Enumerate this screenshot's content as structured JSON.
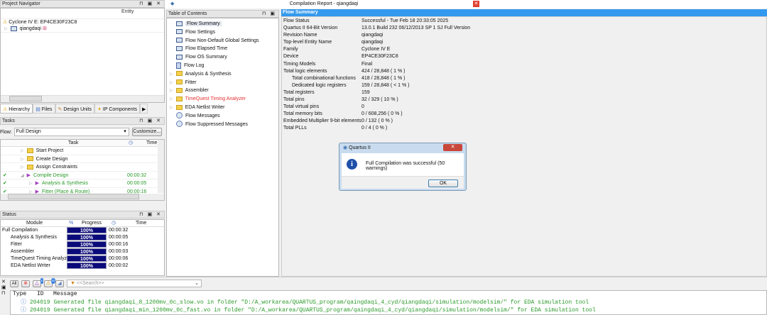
{
  "project_navigator": {
    "title": "Project Navigator",
    "column": "Entity",
    "device": "Cyclone IV E: EP4CE30F23C8",
    "entity": "qiangdaqi",
    "tabs": [
      "Hierarchy",
      "Files",
      "Design Units",
      "IP Components"
    ]
  },
  "tasks": {
    "title": "Tasks",
    "flow_label": "Flow:",
    "flow_value": "Full Design",
    "customize": "Customize...",
    "col_task": "Task",
    "col_time": "Time",
    "rows": [
      {
        "label": "Start Project",
        "time": "",
        "done": false,
        "level": 1
      },
      {
        "label": "Create Design",
        "time": "",
        "done": false,
        "level": 1
      },
      {
        "label": "Assign Constraints",
        "time": "",
        "done": false,
        "level": 1
      },
      {
        "label": "Compile Design",
        "time": "00:00:32",
        "done": true,
        "level": 1
      },
      {
        "label": "Analysis & Synthesis",
        "time": "00:00:05",
        "done": true,
        "level": 2
      },
      {
        "label": "Fitter (Place & Route)",
        "time": "00:00:16",
        "done": true,
        "level": 2
      }
    ]
  },
  "status": {
    "title": "Status",
    "col_module": "Module",
    "col_progress": "Progress",
    "col_time": "Time",
    "rows": [
      {
        "module": "Full Compilation",
        "progress": "100%",
        "time": "00:00:32"
      },
      {
        "module": "Analysis & Synthesis",
        "progress": "100%",
        "time": "00:00:05"
      },
      {
        "module": "Fitter",
        "progress": "100%",
        "time": "00:00:16"
      },
      {
        "module": "Assembler",
        "progress": "100%",
        "time": "00:00:03"
      },
      {
        "module": "TimeQuest Timing Analyzer",
        "progress": "100%",
        "time": "00:00:06"
      },
      {
        "module": "EDA Netlist Writer",
        "progress": "100%",
        "time": "00:00:02"
      }
    ]
  },
  "report": {
    "title": "Compilation Report - qiangdaqi",
    "toc_title": "Table of Contents",
    "toc": [
      {
        "label": "Flow Summary",
        "type": "table"
      },
      {
        "label": "Flow Settings",
        "type": "table"
      },
      {
        "label": "Flow Non-Default Global Settings",
        "type": "table"
      },
      {
        "label": "Flow Elapsed Time",
        "type": "table"
      },
      {
        "label": "Flow OS Summary",
        "type": "table"
      },
      {
        "label": "Flow Log",
        "type": "doc"
      },
      {
        "label": "Analysis & Synthesis",
        "type": "folder"
      },
      {
        "label": "Fitter",
        "type": "folder"
      },
      {
        "label": "Assembler",
        "type": "folder"
      },
      {
        "label": "TimeQuest Timing Analyzer",
        "type": "folder",
        "color": "#e83030"
      },
      {
        "label": "EDA Netlist Writer",
        "type": "folder"
      },
      {
        "label": "Flow Messages",
        "type": "info"
      },
      {
        "label": "Flow Suppressed Messages",
        "type": "info"
      }
    ],
    "summary_title": "Flow Summary",
    "summary": [
      [
        "Flow Status",
        "Successful - Tue Feb 18 20:33:05 2025",
        0
      ],
      [
        "Quartus II 64-Bit Version",
        "13.0.1 Build 232 06/12/2013 SP 1 SJ Full Version",
        0
      ],
      [
        "Revision Name",
        "qiangdaqi",
        0
      ],
      [
        "Top-level Entity Name",
        "qiangdaqi",
        0
      ],
      [
        "Family",
        "Cyclone IV E",
        0
      ],
      [
        "Device",
        "EP4CE30F23C8",
        0
      ],
      [
        "Timing Models",
        "Final",
        0
      ],
      [
        "Total logic elements",
        "424 / 28,848 ( 1 % )",
        0
      ],
      [
        "Total combinational functions",
        "418 / 28,848 ( 1 % )",
        1
      ],
      [
        "Dedicated logic registers",
        "159 / 28,848 ( < 1 % )",
        1
      ],
      [
        "Total registers",
        "159",
        0
      ],
      [
        "Total pins",
        "32 / 329 ( 10 % )",
        0
      ],
      [
        "Total virtual pins",
        "0",
        0
      ],
      [
        "Total memory bits",
        "0 / 608,256 ( 0 % )",
        0
      ],
      [
        "Embedded Multiplier 9-bit elements",
        "0 / 132 ( 0 % )",
        0
      ],
      [
        "Total PLLs",
        "0 / 4 ( 0 % )",
        0
      ]
    ]
  },
  "dialog": {
    "title": "Quartus II",
    "message": "Full Compilation was successful (50 warnings)",
    "ok": "OK"
  },
  "messages": {
    "all": "All",
    "badge_critical": "6",
    "badge_warning": "50",
    "search_placeholder": "<<Search>>",
    "col_type": "Type",
    "col_id": "ID",
    "col_message": "Message",
    "rows": [
      {
        "id": "204019",
        "text": "Generated file qiangdaqi_8_1200mv_0c_slow.vo in folder \"D:/A_workarea/QUARTUS_program/qaingdaqi_4_cyd/qiangdaqi/simulation/modelsim/\" for EDA simulation tool"
      },
      {
        "id": "204019",
        "text": "Generated file qiangdaqi_min_1200mv_0c_fast.vo in folder \"D:/A_workarea/QUARTUS_program/qaingdaqi_4_cyd/qiangdaqi/simulation/modelsim/\" for EDA simulation tool"
      }
    ]
  }
}
